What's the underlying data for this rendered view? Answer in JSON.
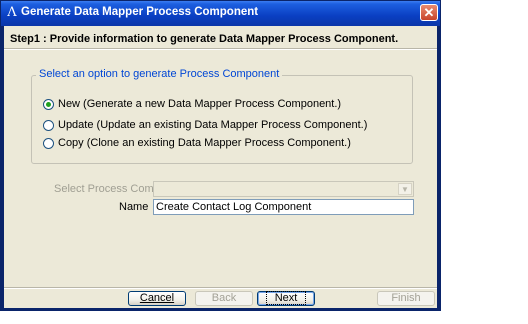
{
  "window": {
    "title": "Generate Data Mapper Process Component",
    "app_icon_glyph": "Λ",
    "close_glyph": "✕"
  },
  "step": {
    "label": "Step1 : Provide information to generate Data Mapper Process Component."
  },
  "options_group": {
    "legend": "Select an option to generate Process Component",
    "options": [
      {
        "label": "New (Generate a new Data Mapper Process Component.)",
        "selected": true
      },
      {
        "label": "Update (Update an existing Data Mapper Process Component.)",
        "selected": false
      },
      {
        "label": "Copy (Clone an existing Data Mapper Process Component.)",
        "selected": false
      }
    ]
  },
  "fields": {
    "select_process_component": {
      "label": "Select Process Component",
      "value": "",
      "enabled": false,
      "arrow_glyph": "▼"
    },
    "name": {
      "label": "Name",
      "value": "Create Contact Log Component"
    }
  },
  "buttons": {
    "cancel": {
      "label": "Cancel",
      "enabled": true
    },
    "back": {
      "label": "Back",
      "enabled": false
    },
    "next": {
      "label": "Next",
      "enabled": true,
      "default": true
    },
    "finish": {
      "label": "Finish",
      "enabled": false
    }
  },
  "colors": {
    "titlebar": "#0a3fc2",
    "client_bg": "#ece9d8",
    "group_legend": "#0046d5",
    "radio_selected": "#21a121",
    "close_button": "#c8442c"
  }
}
